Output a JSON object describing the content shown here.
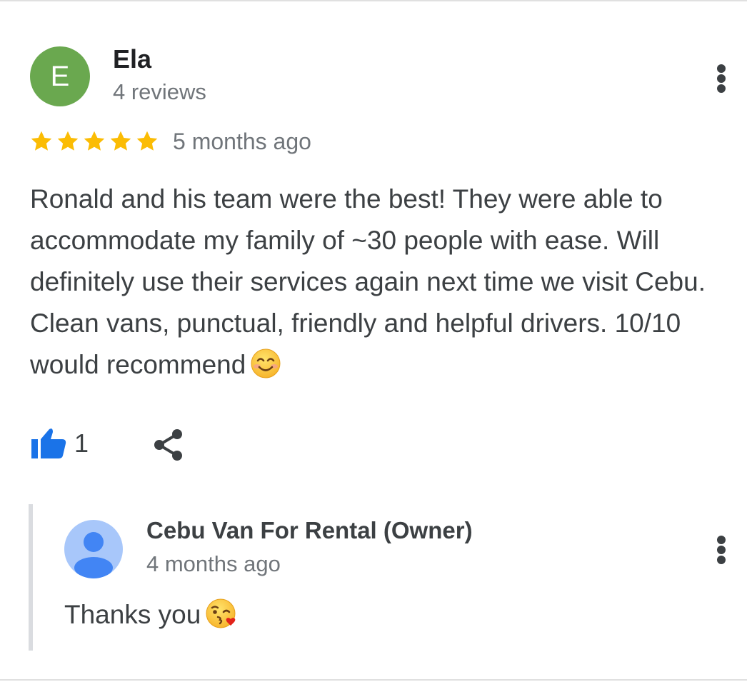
{
  "review": {
    "avatar_letter": "E",
    "avatar_color": "#6aa84f",
    "reviewer_name": "Ela",
    "reviewer_meta": "4 reviews",
    "rating": 5,
    "rating_max": 5,
    "star_color": "#fbbc04",
    "date": "5 months ago",
    "text": "Ronald and his team were the best! They were able to accommodate my family of ~30 people with ease. Will definitely use their services again next time we visit Cebu. Clean vans, punctual, friendly and helpful drivers. 10/10 would recommend",
    "emoji": "smiling-face-with-smiling-eyes",
    "like_count": "1",
    "like_color": "#1a73e8",
    "more_icon": "more-vert-icon",
    "share_icon": "share-icon"
  },
  "owner_reply": {
    "owner_name": "Cebu Van For Rental (Owner)",
    "date": "4 months ago",
    "text": "Thanks you",
    "emoji": "face-blowing-a-kiss",
    "avatar_color": "#a8c7fa",
    "more_icon": "more-vert-icon"
  }
}
